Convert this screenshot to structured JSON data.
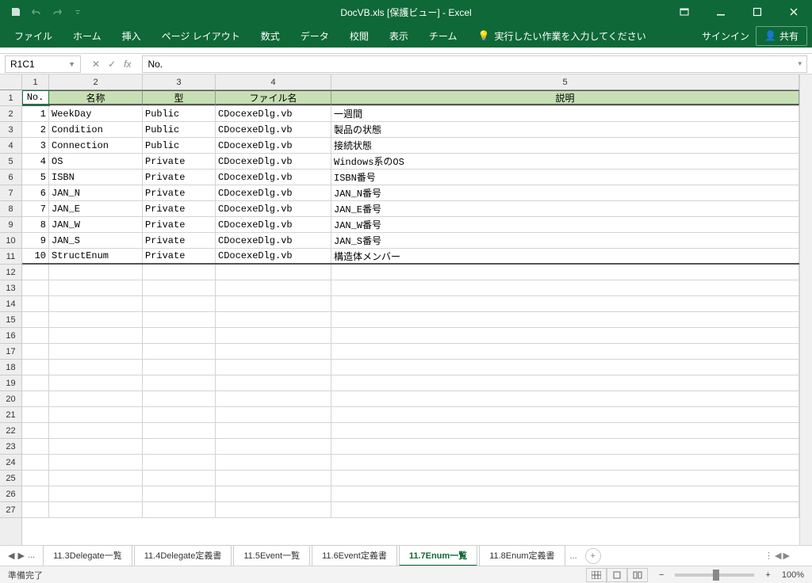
{
  "title": "DocVB.xls  [保護ビュー] - Excel",
  "qat": {
    "save": "保存",
    "undo": "元に戻す",
    "redo": "やり直し"
  },
  "ribbon": {
    "file": "ファイル",
    "home": "ホーム",
    "insert": "挿入",
    "layout": "ページ レイアウト",
    "formulas": "数式",
    "data": "データ",
    "review": "校閲",
    "view": "表示",
    "team": "チーム",
    "tell": "実行したい作業を入力してください",
    "signin": "サインイン",
    "share": "共有"
  },
  "namebox": "R1C1",
  "formula": "No.",
  "colHeaders": [
    "1",
    "2",
    "3",
    "4",
    "5"
  ],
  "headerRow": {
    "c1": "No.",
    "c2": "名称",
    "c3": "型",
    "c4": "ファイル名",
    "c5": "説明"
  },
  "rows": [
    {
      "n": "1",
      "name": "WeekDay",
      "type": "Public",
      "file": "CDocexeDlg.vb",
      "desc": "一週間"
    },
    {
      "n": "2",
      "name": "Condition",
      "type": "Public",
      "file": "CDocexeDlg.vb",
      "desc": "製品の状態"
    },
    {
      "n": "3",
      "name": "Connection",
      "type": "Public",
      "file": "CDocexeDlg.vb",
      "desc": "接続状態"
    },
    {
      "n": "4",
      "name": "OS",
      "type": "Private",
      "file": "CDocexeDlg.vb",
      "desc": "Windows系のOS"
    },
    {
      "n": "5",
      "name": "ISBN",
      "type": "Private",
      "file": "CDocexeDlg.vb",
      "desc": "ISBN番号"
    },
    {
      "n": "6",
      "name": "JAN_N",
      "type": "Private",
      "file": "CDocexeDlg.vb",
      "desc": "JAN_N番号"
    },
    {
      "n": "7",
      "name": "JAN_E",
      "type": "Private",
      "file": "CDocexeDlg.vb",
      "desc": "JAN_E番号"
    },
    {
      "n": "8",
      "name": "JAN_W",
      "type": "Private",
      "file": "CDocexeDlg.vb",
      "desc": "JAN_W番号"
    },
    {
      "n": "9",
      "name": "JAN_S",
      "type": "Private",
      "file": "CDocexeDlg.vb",
      "desc": "JAN_S番号"
    },
    {
      "n": "10",
      "name": "StructEnum",
      "type": "Private",
      "file": "CDocexeDlg.vb",
      "desc": "構造体メンバー"
    }
  ],
  "blankRowStart": 12,
  "sheetTabs": [
    {
      "label": "11.3Delegate一覧",
      "active": false
    },
    {
      "label": "11.4Delegate定義書",
      "active": false
    },
    {
      "label": "11.5Event一覧",
      "active": false
    },
    {
      "label": "11.6Event定義書",
      "active": false
    },
    {
      "label": "11.7Enum一覧",
      "active": true
    },
    {
      "label": "11.8Enum定義書",
      "active": false
    }
  ],
  "ellipsis": "...",
  "status": {
    "ready": "準備完了",
    "zoom": "100%"
  }
}
